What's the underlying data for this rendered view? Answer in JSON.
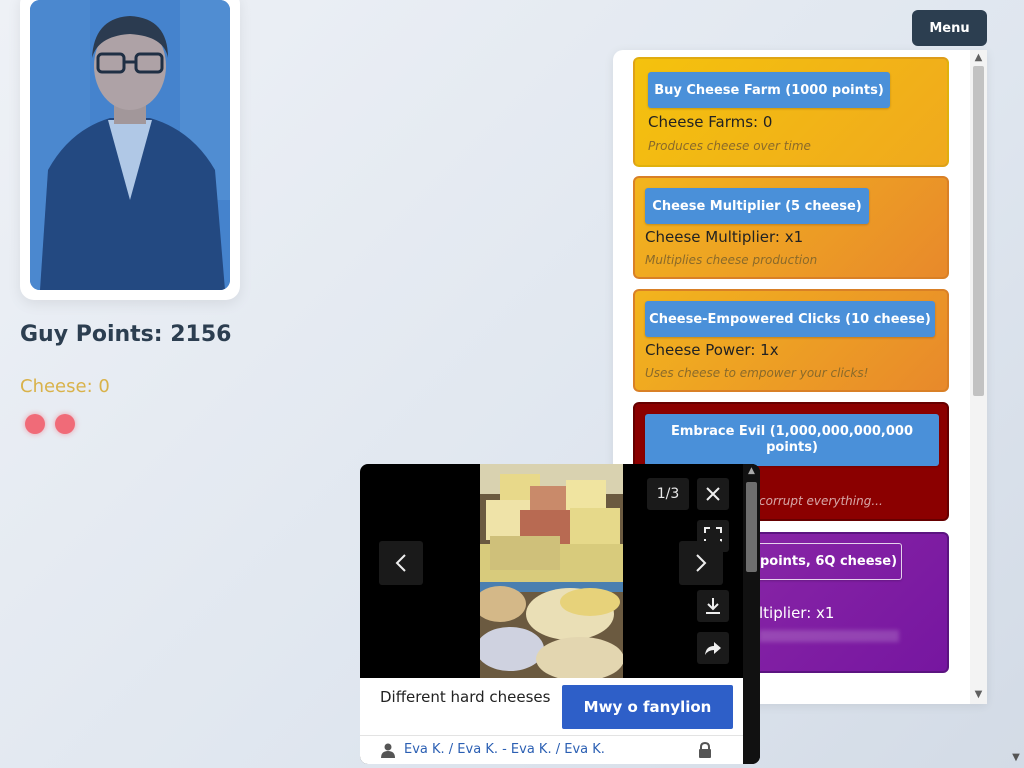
{
  "header": {
    "menu_label": "Menu"
  },
  "stats": {
    "guy_points": "Guy Points: 2156",
    "cheese": "Cheese: 0"
  },
  "shop": {
    "items": [
      {
        "button": "Buy Cheese Farm (1000 points)",
        "stat": "Cheese Farms: 0",
        "desc": "Produces cheese over time"
      },
      {
        "button": "Cheese Multiplier (5 cheese)",
        "stat": "Cheese Multiplier: x1",
        "desc": "Multiplies cheese production"
      },
      {
        "button": "Cheese-Empowered Clicks (10 cheese)",
        "stat": "Cheese Power: 1x",
        "desc": "Uses cheese to empower your clicks!"
      },
      {
        "button": "Embrace Evil (1,000,000,000,000 points)",
        "stat": "",
        "desc": "corrupt everything..."
      },
      {
        "button": "points, 6Q cheese)",
        "stat": "ltiplier: x1",
        "desc": ""
      }
    ]
  },
  "viewer": {
    "counter": "1/3",
    "caption": "Different hard cheeses",
    "action_label": "Mwy o fanylion",
    "credit": "Eva K. / Eva K. - Eva K. / Eva K.",
    "icons": [
      "close-icon",
      "fullscreen-icon",
      "download-icon",
      "share-icon",
      "chevron-left-icon",
      "chevron-right-icon",
      "person-icon",
      "lock-icon"
    ]
  },
  "colors": {
    "accent_blue": "#4a90d9",
    "evil_red": "#8b0000",
    "purple": "#8e2aa8",
    "gold": "#f4c20d",
    "action_blue": "#2e5fc8"
  }
}
